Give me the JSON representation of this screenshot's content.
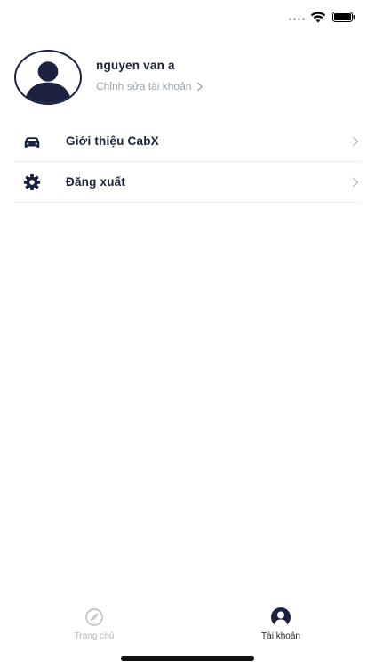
{
  "status_bar": {
    "signal_icon": "cellular-signal-icon",
    "wifi_icon": "wifi-icon",
    "battery_icon": "battery-icon"
  },
  "profile": {
    "name": "nguyen van a",
    "edit_label": "Chỉnh sửa tài khoản",
    "avatar_icon": "user-avatar-icon"
  },
  "menu": {
    "items": [
      {
        "label": "Giới thiệu CabX",
        "icon": "car-icon"
      },
      {
        "label": "Đăng xuất",
        "icon": "gear-icon"
      }
    ]
  },
  "tab_bar": {
    "tabs": [
      {
        "label": "Trang chủ",
        "icon": "compass-icon",
        "active": false
      },
      {
        "label": "Tài khoản",
        "icon": "user-icon",
        "active": true
      }
    ]
  },
  "colors": {
    "primary": "#1b2240",
    "text": "#1b2236",
    "muted": "#9aa0aa",
    "inactive_tab": "#b5b8bd",
    "divider": "#eeeeee"
  }
}
